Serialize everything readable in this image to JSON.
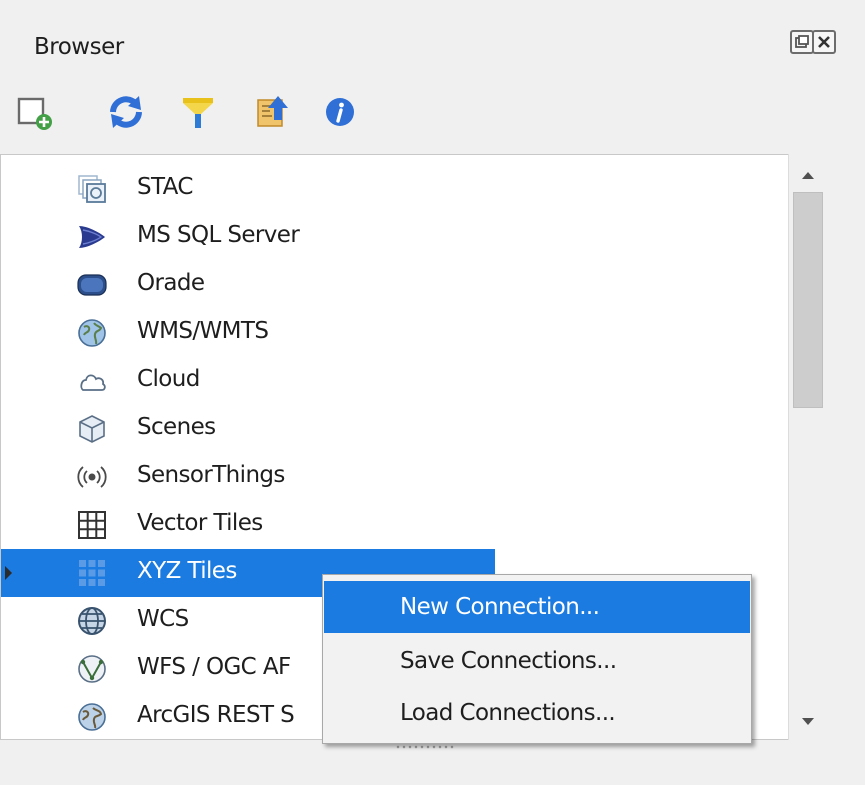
{
  "panel": {
    "title": "Browser"
  },
  "toolbar": {
    "items": [
      {
        "icon": "add-selected-layers-icon"
      },
      {
        "icon": "refresh-icon"
      },
      {
        "icon": "filter-icon"
      },
      {
        "icon": "collapse-all-icon"
      },
      {
        "icon": "properties-info-icon"
      }
    ]
  },
  "tree": {
    "items": [
      {
        "label": "STAC",
        "icon": "stac-icon"
      },
      {
        "label": "MS SQL Server",
        "icon": "mssql-icon"
      },
      {
        "label": "Orade",
        "icon": "oracle-icon"
      },
      {
        "label": "WMS/WMTS",
        "icon": "wms-globe-icon"
      },
      {
        "label": "Cloud",
        "icon": "cloud-icon"
      },
      {
        "label": "Scenes",
        "icon": "scenes-icon"
      },
      {
        "label": "SensorThings",
        "icon": "sensorthings-icon"
      },
      {
        "label": "Vector Tiles",
        "icon": "vector-tiles-icon"
      },
      {
        "label": "XYZ Tiles",
        "icon": "xyz-tiles-icon",
        "selected": true
      },
      {
        "label": "WCS",
        "icon": "wcs-globe-icon"
      },
      {
        "label": "WFS / OGC AF",
        "icon": "wfs-globe-icon"
      },
      {
        "label": "ArcGIS REST S",
        "icon": "arcgis-globe-icon"
      }
    ]
  },
  "context_menu": {
    "items": [
      {
        "label": "New Connection...",
        "active": true
      },
      {
        "label": "Save Connections..."
      },
      {
        "label": "Load Connections..."
      }
    ]
  },
  "colors": {
    "selection": "#1b7be0",
    "accent_refresh": "#2f6fd6",
    "accent_filter": "#e8c21a",
    "accent_add": "#4caf50"
  }
}
